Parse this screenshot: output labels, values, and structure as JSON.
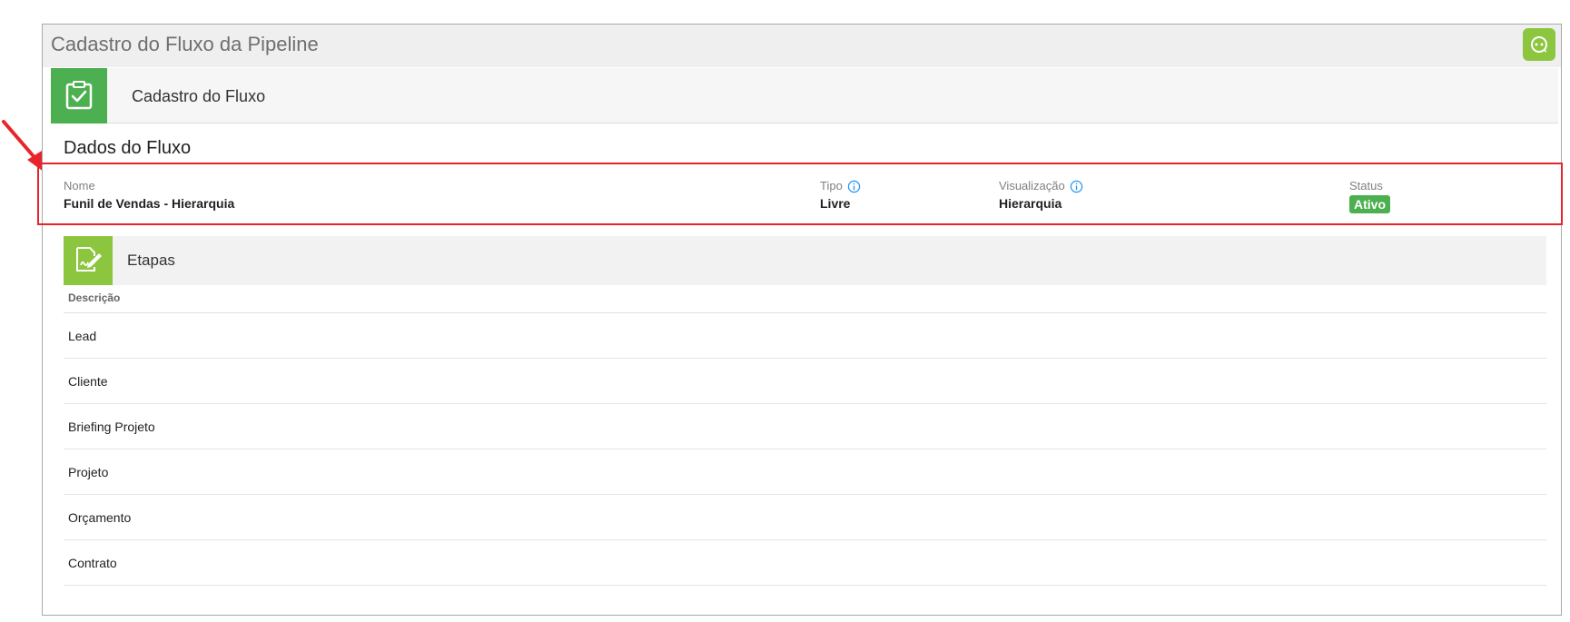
{
  "window": {
    "title": "Cadastro do Fluxo da Pipeline"
  },
  "section_header": {
    "label": "Cadastro do Fluxo"
  },
  "dados": {
    "title": "Dados do Fluxo",
    "nome": {
      "label": "Nome",
      "value": "Funil de Vendas - Hierarquia"
    },
    "tipo": {
      "label": "Tipo",
      "value": "Livre"
    },
    "visualizacao": {
      "label": "Visualização",
      "value": "Hierarquia"
    },
    "status": {
      "label": "Status",
      "value": "Ativo"
    }
  },
  "etapas": {
    "label": "Etapas",
    "column_header": "Descrição",
    "rows": [
      "Lead",
      "Cliente",
      "Briefing Projeto",
      "Projeto",
      "Orçamento",
      "Contrato"
    ]
  },
  "colors": {
    "accent_green": "#4caf50",
    "light_green": "#8cc63f",
    "highlight_red": "#e8242b",
    "info_blue": "#2196f3"
  },
  "icons": {
    "help": "help-chat-icon",
    "section": "clipboard-check-icon",
    "etapas": "document-edit-icon",
    "info": "info-icon",
    "annotation": "red-arrow-icon"
  }
}
